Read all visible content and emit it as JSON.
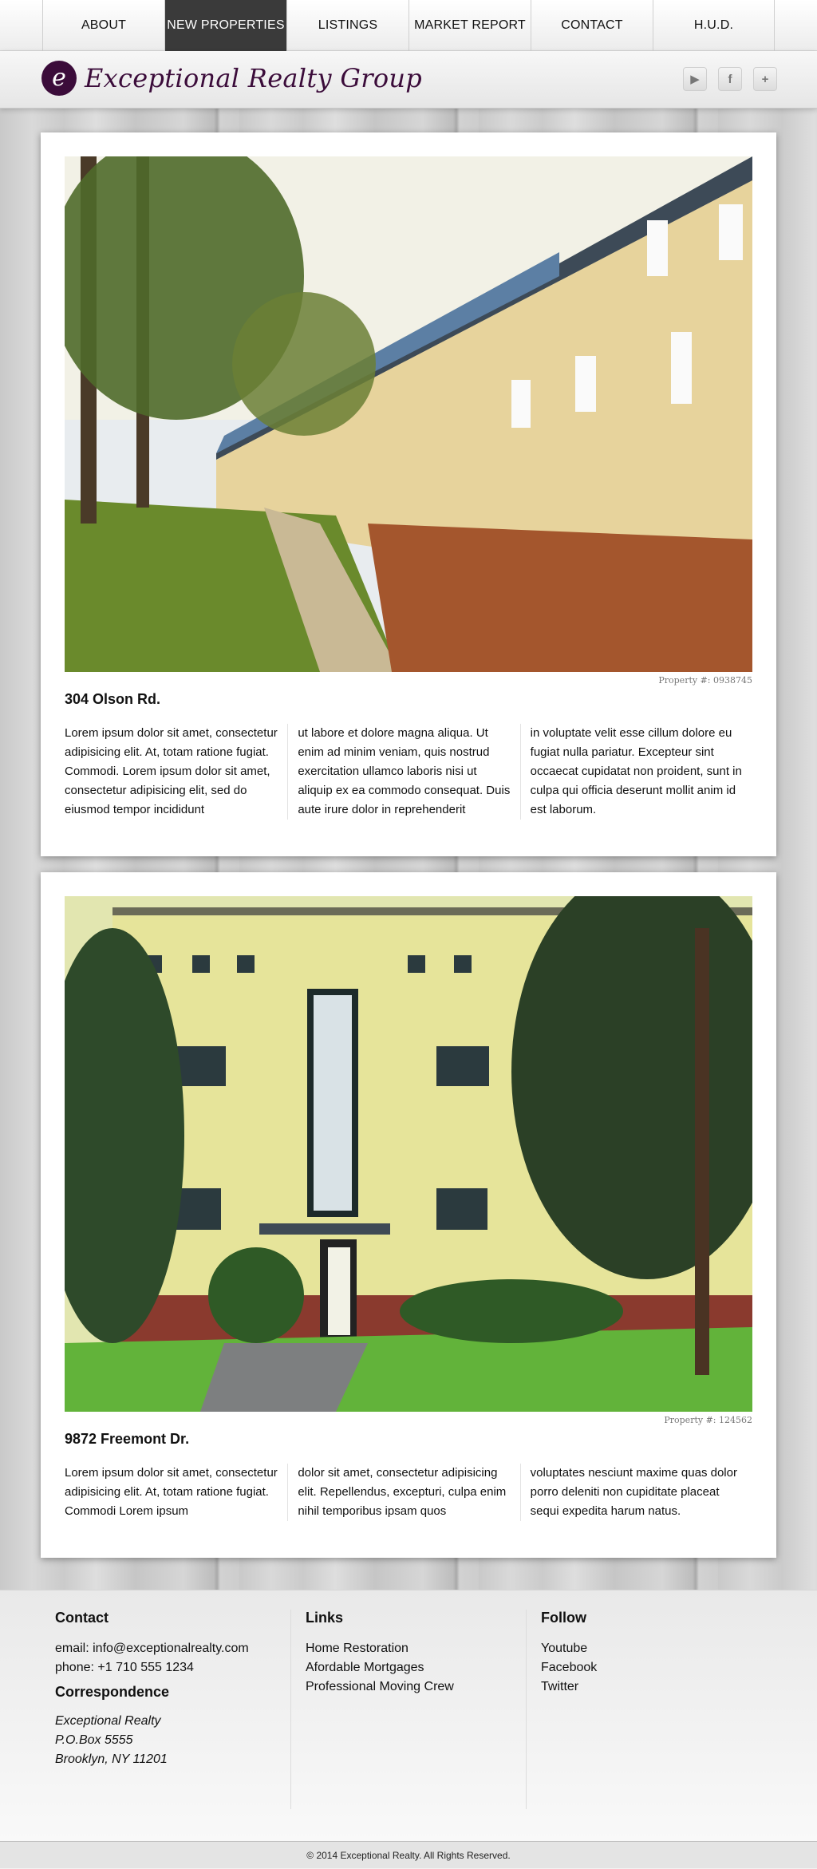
{
  "nav": {
    "items": [
      "ABOUT",
      "NEW PROPERTIES",
      "LISTINGS",
      "MARKET REPORT",
      "CONTACT",
      "H.U.D."
    ],
    "active_index": 1
  },
  "brand": {
    "mark": "e",
    "name": "Exceptional Realty Group"
  },
  "social": {
    "icons": [
      "twitter-icon",
      "facebook-icon",
      "plus-icon"
    ],
    "glyphs": [
      "▶",
      "f",
      "+"
    ]
  },
  "properties": [
    {
      "property_number": "Property #: 0938745",
      "title": "304 Olson Rd.",
      "columns": [
        "Lorem ipsum dolor sit amet, consectetur adipisicing elit. At, totam ratione fugiat. Commodi. Lorem ipsum dolor sit amet, consectetur adipisicing elit, sed do eiusmod tempor incididunt",
        "ut labore et dolore magna aliqua. Ut enim ad minim veniam, quis nostrud exercitation ullamco laboris nisi ut aliquip ex ea commodo consequat. Duis aute irure dolor in reprehenderit",
        "in voluptate velit esse cillum dolore eu fugiat nulla pariatur. Excepteur sint occaecat cupidatat non proident, sunt in culpa qui officia deserunt mollit anim id est laborum."
      ]
    },
    {
      "property_number": "Property #: 124562",
      "title": "9872 Freemont Dr.",
      "columns": [
        "Lorem ipsum dolor sit amet, consectetur adipisicing elit. At, totam ratione fugiat. Commodi Lorem ipsum",
        "dolor sit amet, consectetur adipisicing elit. Repellendus, excepturi, culpa enim nihil temporibus ipsam quos",
        "voluptates nesciunt maxime quas dolor porro deleniti non cupiditate placeat sequi expedita harum natus."
      ]
    }
  ],
  "footer": {
    "contact_heading": "Contact",
    "email": "email: info@exceptionalrealty.com",
    "phone": "phone: +1 710 555 1234",
    "correspondence_heading": "Correspondence",
    "address": [
      "Exceptional Realty",
      "P.O.Box 5555",
      "Brooklyn, NY 11201"
    ],
    "links_heading": "Links",
    "links": [
      "Home Restoration",
      "Afordable Mortgages",
      "Professional Moving Crew"
    ],
    "follow_heading": "Follow",
    "follow": [
      "Youtube",
      "Facebook",
      "Twitter"
    ],
    "copyright": "© 2014 Exceptional Realty. All Rights Reserved."
  }
}
